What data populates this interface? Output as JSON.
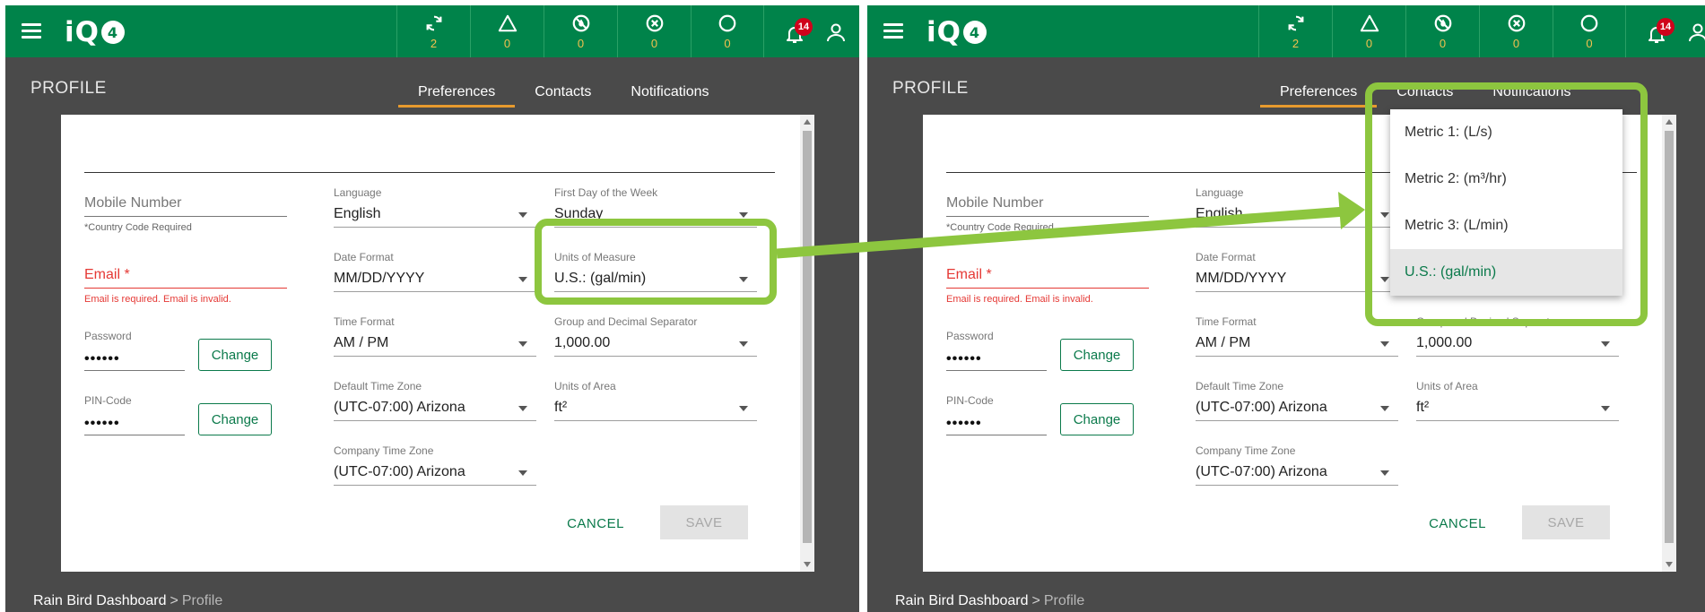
{
  "app": {
    "logo_text": "iQ",
    "logo_badge": "4"
  },
  "status": [
    {
      "icon": "sync-icon",
      "count": "2"
    },
    {
      "icon": "warning-triangle-icon",
      "count": "0"
    },
    {
      "icon": "no-water-icon",
      "count": "0"
    },
    {
      "icon": "x-circle-icon",
      "count": "0"
    },
    {
      "icon": "circle-icon",
      "count": "0"
    }
  ],
  "notifications": {
    "count": "14"
  },
  "page": {
    "title": "PROFILE"
  },
  "tabs": [
    {
      "label": "Preferences",
      "active": true
    },
    {
      "label": "Contacts",
      "active": false
    },
    {
      "label": "Notifications",
      "active": false
    }
  ],
  "form": {
    "mobile_placeholder": "Mobile Number",
    "mobile_help": "*Country Code Required",
    "email_label": "Email *",
    "email_error": "Email is required. Email is invalid.",
    "password_label": "Password",
    "password_value": "••••••",
    "pin_label": "PIN-Code",
    "pin_value": "••••••",
    "change_label": "Change",
    "language_label": "Language",
    "language_value": "English",
    "date_format_label": "Date Format",
    "date_format_value": "MM/DD/YYYY",
    "time_format_label": "Time Format",
    "time_format_value": "AM / PM",
    "default_tz_label": "Default Time Zone",
    "default_tz_value": "(UTC-07:00) Arizona",
    "company_tz_label": "Company Time Zone",
    "company_tz_value": "(UTC-07:00) Arizona",
    "first_day_label": "First Day of the Week",
    "first_day_value": "Sunday",
    "units_measure_label": "Units of Measure",
    "units_measure_value": "U.S.: (gal/min)",
    "separator_label": "Group and Decimal Separator",
    "separator_value": "1,000.00",
    "units_area_label": "Units of Area",
    "units_area_value": "ft²",
    "cancel_label": "CANCEL",
    "save_label": "SAVE"
  },
  "units_dropdown": {
    "options": [
      "Metric 1: (L/s)",
      "Metric 2: (m³/hr)",
      "Metric 3: (L/min)",
      "U.S.: (gal/min)"
    ],
    "selected": "U.S.: (gal/min)"
  },
  "breadcrumb": {
    "root": "Rain Bird Dashboard",
    "separator": ">",
    "current": "Profile"
  },
  "colors": {
    "brand_green": "#00834a",
    "highlight": "#8dc63f",
    "tab_underline": "#e79a2e",
    "error": "#e53935"
  }
}
